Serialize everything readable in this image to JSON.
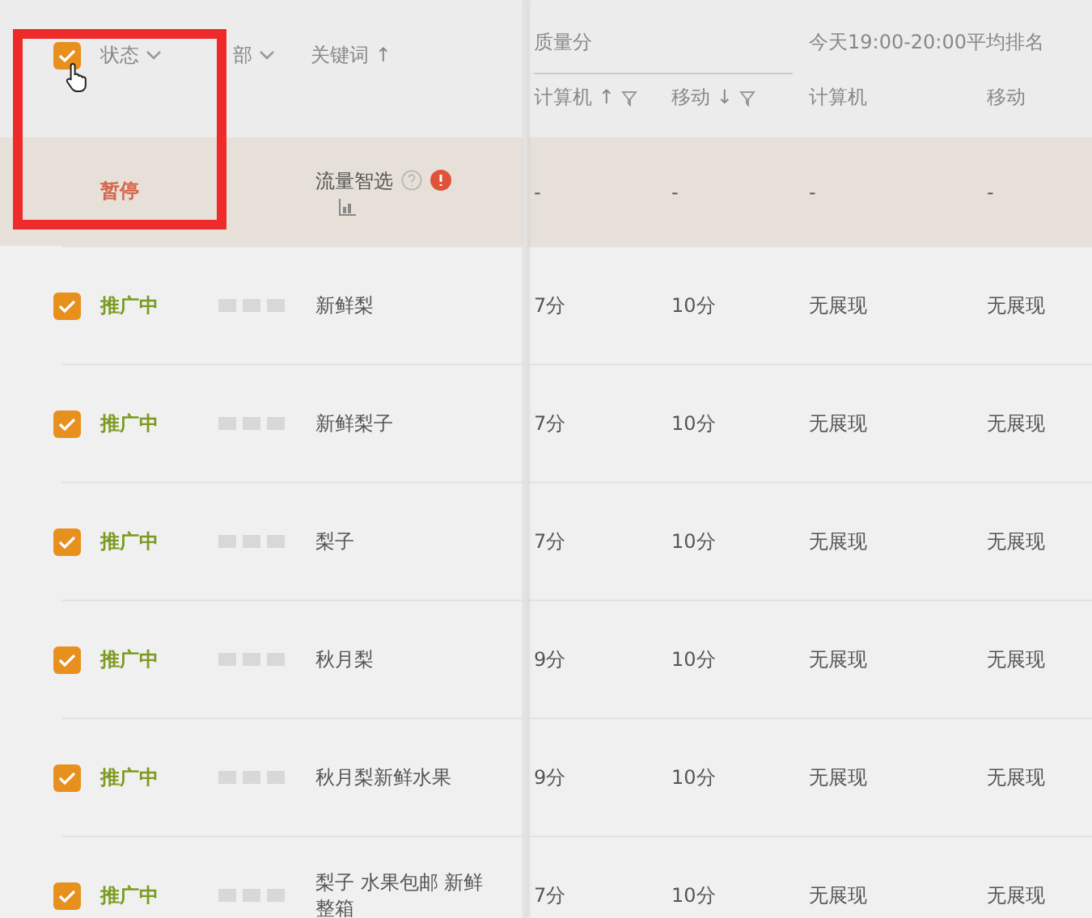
{
  "header": {
    "checked": true,
    "status_label": "状态",
    "filter_label": "部",
    "keyword_label": "关键词 ↑",
    "quality_group": "质量分",
    "rank_group": "今天19:00-20:00平均排名",
    "columns": [
      {
        "label": "计算机 ↑",
        "filter": true
      },
      {
        "label": "移动 ↓",
        "filter": true
      },
      {
        "label": "计算机",
        "filter": false
      },
      {
        "label": "移动",
        "filter": false
      }
    ]
  },
  "rows": [
    {
      "kind": "smart",
      "status": "暂停",
      "keyword": "流量智选",
      "values": [
        "-",
        "-",
        "-",
        "-"
      ]
    },
    {
      "kind": "normal",
      "checked": true,
      "status": "推广中",
      "keyword": "新鲜梨",
      "values": [
        "7分",
        "10分",
        "无展现",
        "无展现"
      ]
    },
    {
      "kind": "normal",
      "checked": true,
      "status": "推广中",
      "keyword": "新鲜梨子",
      "values": [
        "7分",
        "10分",
        "无展现",
        "无展现"
      ]
    },
    {
      "kind": "normal",
      "checked": true,
      "status": "推广中",
      "keyword": "梨子",
      "values": [
        "7分",
        "10分",
        "无展现",
        "无展现"
      ]
    },
    {
      "kind": "normal",
      "checked": true,
      "status": "推广中",
      "keyword": "秋月梨",
      "values": [
        "9分",
        "10分",
        "无展现",
        "无展现"
      ]
    },
    {
      "kind": "normal",
      "checked": true,
      "status": "推广中",
      "keyword": "秋月梨新鲜水果",
      "values": [
        "9分",
        "10分",
        "无展现",
        "无展现"
      ]
    },
    {
      "kind": "normal",
      "checked": true,
      "status": "推广中",
      "keyword": "梨子 水果包邮 新鲜整箱",
      "values": [
        "7分",
        "10分",
        "无展现",
        "无展现"
      ]
    }
  ],
  "annotation": {
    "kind": "frame"
  }
}
